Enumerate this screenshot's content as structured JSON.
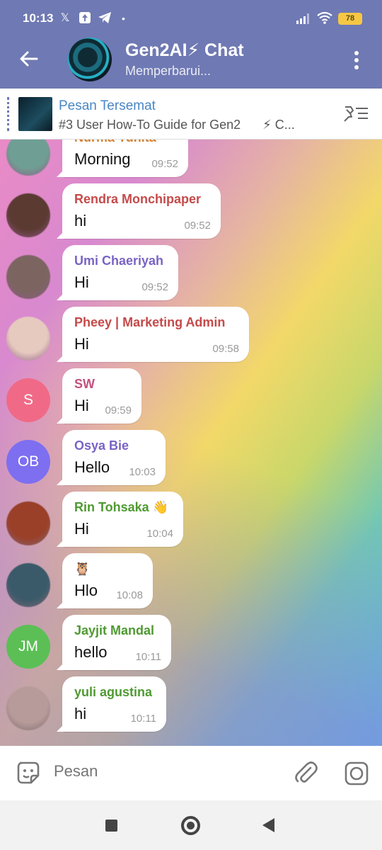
{
  "status_bar": {
    "time": "10:13",
    "battery": "78",
    "notification_icons": [
      "x-icon",
      "upload-icon",
      "telegram-icon"
    ]
  },
  "header": {
    "title": "Gen2AI⚡ Chat",
    "subtitle": "Memperbarui..."
  },
  "pinned": {
    "title": "Pesan Tersemat",
    "text": "#3 User How-To Guide for Gen2",
    "suffix": "⚡ C..."
  },
  "messages": [
    {
      "name": "Nurma Yunita",
      "text": "Morning",
      "time": "09:52",
      "name_color": "#d3802f",
      "avatar": "photo",
      "avatar_color": "#6f9f94",
      "initials": ""
    },
    {
      "name": "Rendra Monchipaper",
      "text": "hi",
      "time": "09:52",
      "name_color": "#c54a4a",
      "avatar": "photo",
      "avatar_color": "#5b3a32",
      "initials": ""
    },
    {
      "name": "Umi Chaeriyah",
      "text": "Hi",
      "time": "09:52",
      "name_color": "#7a63c4",
      "avatar": "photo",
      "avatar_color": "#7c6561",
      "initials": ""
    },
    {
      "name": "Pheey | Marketing Admin",
      "text": "Hi",
      "time": "09:58",
      "name_color": "#c54a4a",
      "avatar": "photo",
      "avatar_color": "#e6c9bf",
      "initials": ""
    },
    {
      "name": "SW",
      "text": "Hi",
      "time": "09:59",
      "name_color": "#c2507e",
      "avatar": "initials",
      "avatar_color": "#f06a87",
      "initials": "S"
    },
    {
      "name": "Osya Bie",
      "text": "Hello",
      "time": "10:03",
      "name_color": "#7a63c4",
      "avatar": "initials",
      "avatar_color": "#7d6ff0",
      "initials": "OB"
    },
    {
      "name": "Rin Tohsaka 👋",
      "text": "Hi",
      "time": "10:04",
      "name_color": "#4f9a32",
      "avatar": "photo",
      "avatar_color": "#9a3f28",
      "initials": ""
    },
    {
      "name": "🦉",
      "text": "Hlo",
      "time": "10:08",
      "name_color": "#8a6a3a",
      "avatar": "photo",
      "avatar_color": "#3a5a6a",
      "initials": ""
    },
    {
      "name": "Jayjit Mandal",
      "text": "hello",
      "time": "10:11",
      "name_color": "#4f9a32",
      "avatar": "initials",
      "avatar_color": "#5bbf55",
      "initials": "JM"
    },
    {
      "name": "yuli agustina",
      "text": "hi",
      "time": "10:11",
      "name_color": "#4f9a32",
      "avatar": "photo",
      "avatar_color": "#b79b9a",
      "initials": ""
    }
  ],
  "input": {
    "placeholder": "Pesan"
  },
  "colors": {
    "header_bg": "#6f79b3",
    "pinned_title": "#4a86c5"
  }
}
